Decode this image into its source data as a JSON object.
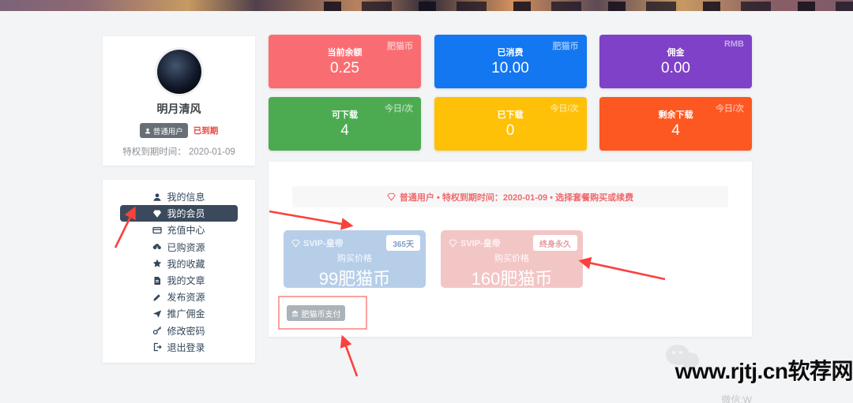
{
  "profile": {
    "username": "明月清风",
    "role_badge": "普通用户",
    "status_badge": "已到期",
    "expiry_label": "特权到期时间：",
    "expiry_date": "2020-01-09"
  },
  "sidebar": {
    "items": [
      {
        "label": "我的信息",
        "icon": "user-icon"
      },
      {
        "label": "我的会员",
        "icon": "gem-icon",
        "active": true
      },
      {
        "label": "充值中心",
        "icon": "credit-card-icon"
      },
      {
        "label": "已购资源",
        "icon": "cloud-download-icon"
      },
      {
        "label": "我的收藏",
        "icon": "star-icon"
      },
      {
        "label": "我的文章",
        "icon": "file-icon"
      },
      {
        "label": "发布资源",
        "icon": "pen-icon"
      },
      {
        "label": "推广佣金",
        "icon": "paper-plane-icon"
      },
      {
        "label": "修改密码",
        "icon": "key-icon"
      },
      {
        "label": "退出登录",
        "icon": "sign-out-icon"
      }
    ]
  },
  "stat_cards": [
    {
      "label": "当前余额",
      "value": "0.25",
      "tag": "肥猫币",
      "color": "#f96d72"
    },
    {
      "label": "已消费",
      "value": "10.00",
      "tag": "肥猫币",
      "color": "#1277f1"
    },
    {
      "label": "佣金",
      "value": "0.00",
      "tag": "RMB",
      "color": "#7e41c8"
    },
    {
      "label": "可下载",
      "value": "4",
      "tag": "今日/次",
      "color": "#4cab51"
    },
    {
      "label": "已下载",
      "value": "0",
      "tag": "今日/次",
      "color": "#fec107"
    },
    {
      "label": "剩余下载",
      "value": "4",
      "tag": "今日/次",
      "color": "#fd5722"
    }
  ],
  "membership": {
    "notice": "普通用户 • 特权到期时间：2020-01-09 • 选择套餐购买或续费",
    "plans": [
      {
        "name": "SVIP-皇帝",
        "badge": "365天",
        "price_label": "购买价格",
        "price": "99肥猫币",
        "color": "#b7cee9",
        "badge_text_color": "#7d9dc4"
      },
      {
        "name": "SVIP-皇帝",
        "badge": "终身永久",
        "price_label": "购买价格",
        "price": "160肥猫币",
        "color": "#f3c6c6",
        "badge_text_color": "#e39aa0"
      }
    ],
    "pay_button": "肥猫币支付"
  },
  "watermark": {
    "text": "www.rjtj.cn软荐网",
    "sub": "微信:W"
  },
  "annotation_color": "#f9423f"
}
